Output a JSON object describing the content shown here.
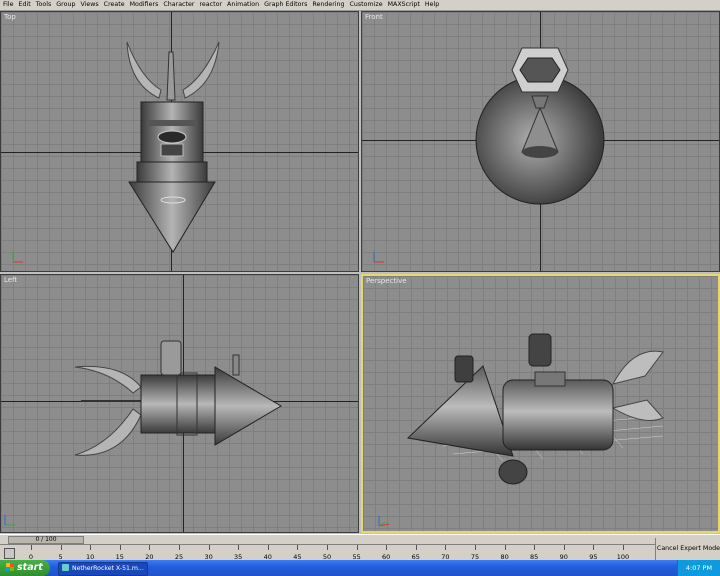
{
  "menu": [
    "File",
    "Edit",
    "Tools",
    "Group",
    "Views",
    "Create",
    "Modifiers",
    "Character",
    "reactor",
    "Animation",
    "Graph Editors",
    "Rendering",
    "Customize",
    "MAXScript",
    "Help"
  ],
  "viewports": {
    "top": {
      "label": "Top"
    },
    "front": {
      "label": "Front"
    },
    "left": {
      "label": "Left"
    },
    "perspective": {
      "label": "Perspective"
    }
  },
  "timeline": {
    "slider_text": "0 / 100",
    "ticks": [
      "0",
      "5",
      "10",
      "15",
      "20",
      "25",
      "30",
      "35",
      "40",
      "45",
      "50",
      "55",
      "60",
      "65",
      "70",
      "75",
      "80",
      "85",
      "90",
      "95",
      "100"
    ]
  },
  "cancel_expert": "Cancel Expert Mode",
  "taskbar": {
    "start": "start",
    "app": "NetherRocket X-51.m...",
    "clock": "4:07 PM"
  },
  "colors": {
    "active_viewport_border": "#e7d76e",
    "viewport_bg": "#8d8d8d"
  }
}
